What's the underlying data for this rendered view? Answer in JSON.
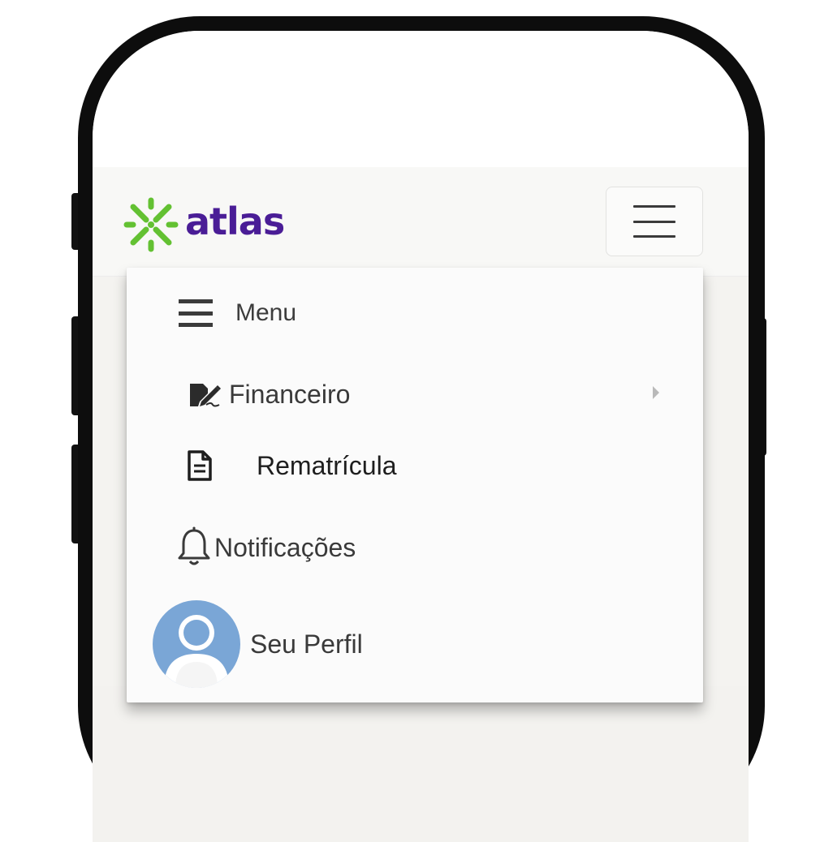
{
  "brand": {
    "name": "atlas",
    "text_color": "#4a1d96",
    "mark_color": "#63c132"
  },
  "navbar": {
    "toggle_icon": "hamburger-icon"
  },
  "dropdown": {
    "header": {
      "icon": "hamburger-icon",
      "label": "Menu"
    },
    "items": [
      {
        "icon": "signature-icon",
        "label": "Financeiro",
        "has_submenu": true
      },
      {
        "icon": "document-icon",
        "label": "Rematrícula"
      },
      {
        "icon": "bell-icon",
        "label": "Notificações"
      },
      {
        "icon": "avatar",
        "label": "Seu Perfil",
        "avatar_color": "#7aa6d6"
      }
    ]
  }
}
